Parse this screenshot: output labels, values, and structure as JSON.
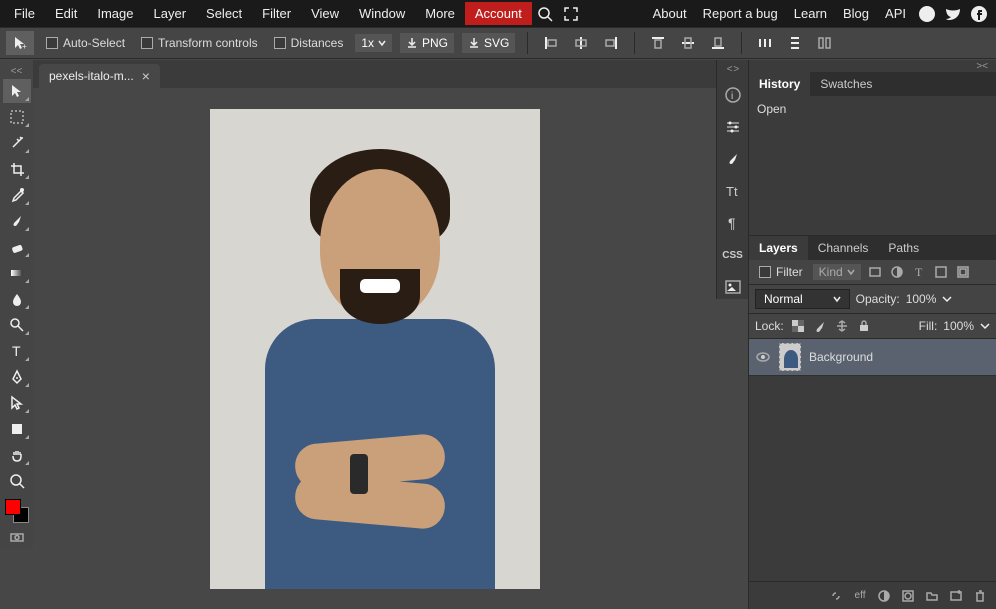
{
  "menu": {
    "items": [
      "File",
      "Edit",
      "Image",
      "Layer",
      "Select",
      "Filter",
      "View",
      "Window",
      "More"
    ],
    "account": "Account",
    "links": [
      "About",
      "Report a bug",
      "Learn",
      "Blog",
      "API"
    ]
  },
  "options": {
    "auto_select": "Auto-Select",
    "transform": "Transform controls",
    "distances": "Distances",
    "zoom": "1x",
    "png": "PNG",
    "svg": "SVG"
  },
  "doc": {
    "tab_name": "pexels-italo-m..."
  },
  "panels": {
    "history_tab": "History",
    "swatches_tab": "Swatches",
    "history_items": [
      "Open"
    ],
    "layers_tab": "Layers",
    "channels_tab": "Channels",
    "paths_tab": "Paths",
    "filter_label": "Filter",
    "kind_label": "Kind",
    "blend_mode": "Normal",
    "opacity_label": "Opacity:",
    "opacity_value": "100%",
    "lock_label": "Lock:",
    "fill_label": "Fill:",
    "fill_value": "100%",
    "layer0": "Background",
    "footer_eff": "eff"
  },
  "colors": {
    "foreground": "#ff0000",
    "background": "#000000"
  }
}
